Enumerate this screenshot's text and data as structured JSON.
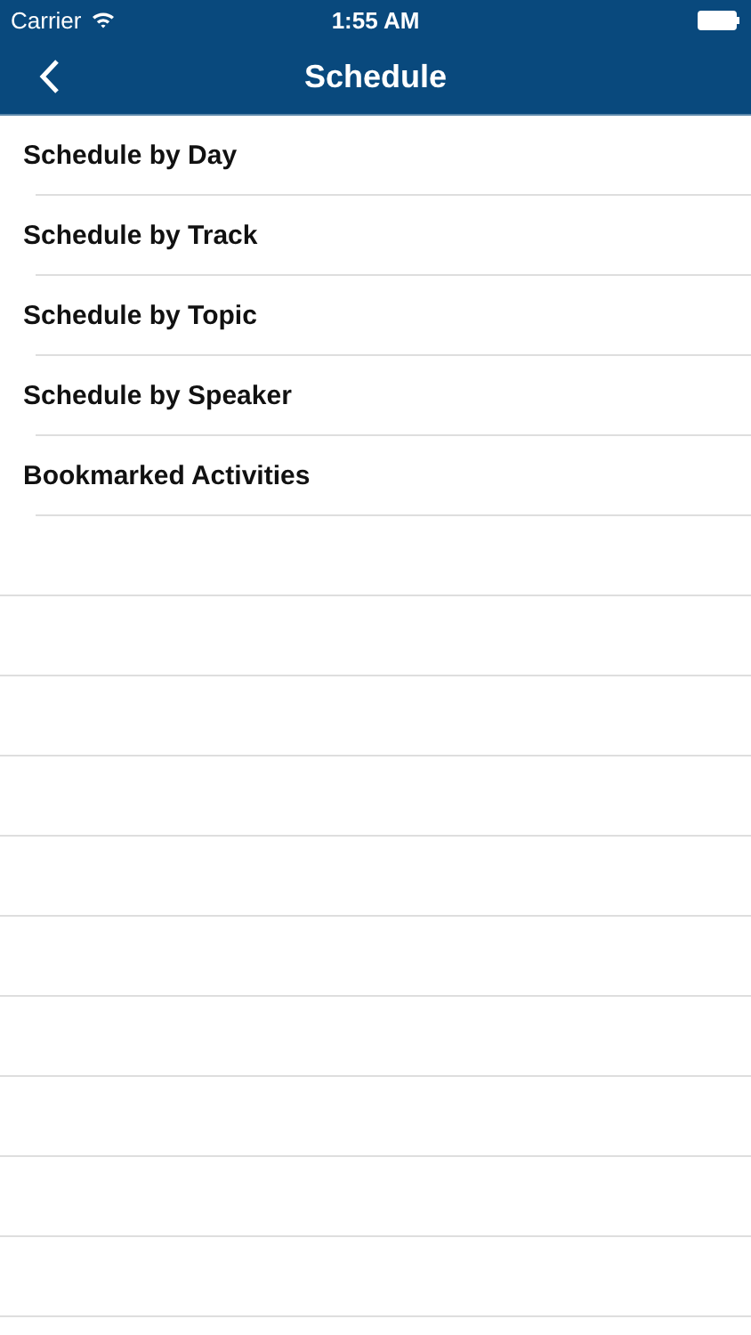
{
  "status_bar": {
    "carrier": "Carrier",
    "time": "1:55 AM"
  },
  "nav_bar": {
    "title": "Schedule"
  },
  "menu_items": [
    {
      "label": "Schedule by Day"
    },
    {
      "label": "Schedule by Track"
    },
    {
      "label": "Schedule by Topic"
    },
    {
      "label": "Schedule by Speaker"
    },
    {
      "label": "Bookmarked Activities"
    }
  ]
}
